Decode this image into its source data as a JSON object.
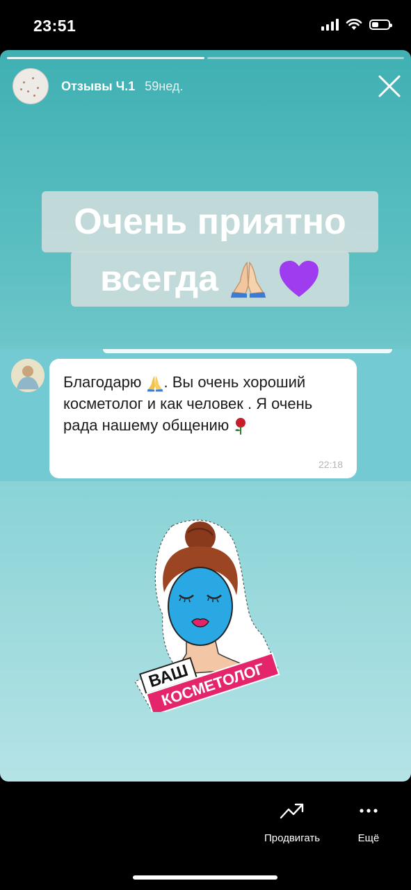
{
  "status_bar": {
    "time": "23:51"
  },
  "story": {
    "title": "Отзывы Ч.1",
    "age": "59нед.",
    "progress_segments": 2,
    "headline": {
      "line1": "Очень приятно",
      "line2": "всегда",
      "emojis": [
        "pray-emoji",
        "purple-heart-emoji"
      ]
    },
    "chat": {
      "message_parts": [
        "Благодарю",
        ". Вы очень хороший косметолог и как человек . Я очень рада нашему общению"
      ],
      "time": "22:18"
    },
    "sticker": {
      "line1": "ВАШ",
      "line2": "КОСМЕТОЛОГ"
    }
  },
  "actions": {
    "promote": "Продвигать",
    "more": "Ещё"
  },
  "colors": {
    "accent_teal": "#5ec0c3",
    "sticker_pink": "#e5256b",
    "mask_blue": "#29a8e3"
  }
}
